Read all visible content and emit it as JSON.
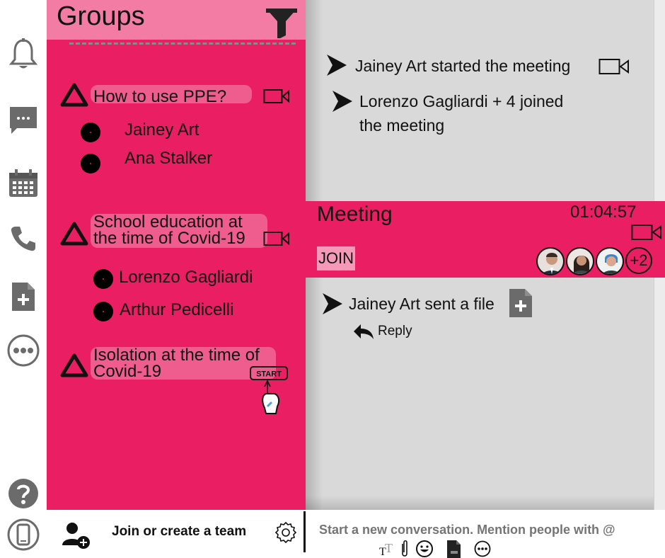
{
  "rail": {
    "items": [
      {
        "name": "notifications-bell-icon"
      },
      {
        "name": "chat-icon"
      },
      {
        "name": "calendar-icon"
      },
      {
        "name": "phone-icon"
      },
      {
        "name": "add-file-icon"
      },
      {
        "name": "more-icon"
      },
      {
        "name": "help-icon"
      },
      {
        "name": "mobile-device-icon"
      }
    ]
  },
  "groups": {
    "title": "Groups",
    "list": [
      {
        "title": "How to use PPE?",
        "members": [
          "Jainey Art",
          "Ana Stalker"
        ]
      },
      {
        "title_line1": "School education at",
        "title_line2": "the time of Covid-19",
        "members": [
          "Lorenzo Gagliardi",
          "Arthur Pedicelli"
        ]
      },
      {
        "title_line1": "Isolation at the time of",
        "title_line2": "Covid-19",
        "badge": "START"
      }
    ]
  },
  "activity": {
    "feed": [
      {
        "text": "Jainey Art started the meeting"
      },
      {
        "text_line1": "Lorenzo Gagliardi + 4 joined",
        "text_line2": "the meeting"
      },
      {
        "text": "Jainey Art sent a file"
      }
    ],
    "reply_label": "Reply"
  },
  "meeting": {
    "title": "Meeting",
    "time": "01:04:57",
    "join_label": "JOIN",
    "more_participants": "+2"
  },
  "bottom": {
    "join_team_label": "Join or create a team",
    "compose_placeholder": "Start a new conversation. Mention people with @"
  },
  "colors": {
    "accent": "#e91e63",
    "panel": "#d9d9d9",
    "icon_gray": "#6b6b6b"
  }
}
